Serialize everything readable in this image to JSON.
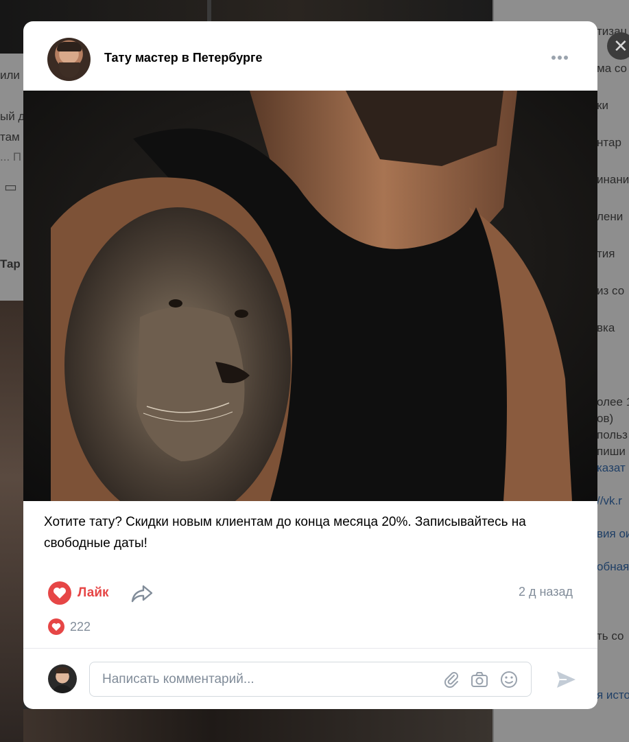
{
  "background": {
    "left_fragments": [
      "или",
      "ый д",
      "там",
      "... П",
      "Тар"
    ],
    "right_fragments": [
      "тизац",
      "ма со",
      "ки",
      "нтар",
      "инани",
      "лени",
      "тия",
      "из со",
      "вка",
      "олее 1",
      "ов)",
      "польз",
      "пиши",
      "казат",
      "//vk.r",
      "вия ои",
      "обная",
      "ть со",
      "я исто"
    ]
  },
  "close_label": "✕",
  "post": {
    "author": "Тату мастер в Петербурге",
    "text": "Хотите тату? Скидки новым клиентам до конца месяца 20%. Записывайтесь на свободные даты!",
    "like_label": "Лайк",
    "liked": true,
    "timestamp": "2 д назад",
    "likes_count": "222"
  },
  "comment": {
    "placeholder": "Написать комментарий..."
  },
  "colors": {
    "accent_red": "#e64646",
    "muted_text": "#818c99",
    "divider": "#e7e8ec"
  },
  "icons": [
    "more-horizontal-icon",
    "heart-icon",
    "share-icon",
    "paperclip-icon",
    "camera-icon",
    "smile-icon",
    "send-icon",
    "close-icon"
  ]
}
